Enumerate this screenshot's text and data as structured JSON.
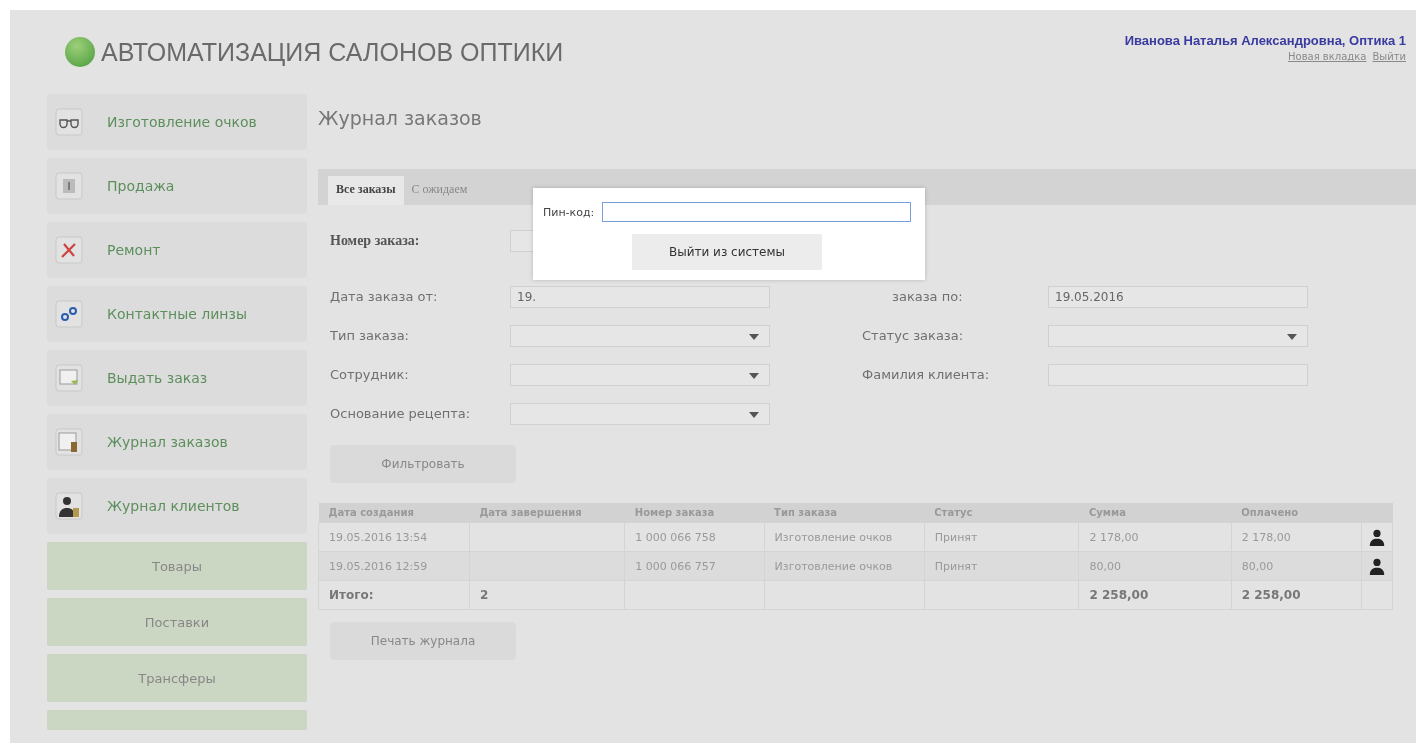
{
  "header": {
    "title": "АВТОМАТИЗАЦИЯ САЛОНОВ ОПТИКИ",
    "user": "Иванова Наталья Александровна, Оптика 1",
    "links": [
      "Новая вкладка",
      "Выйти"
    ]
  },
  "sidebar": {
    "items": [
      {
        "label": "Изготовление очков",
        "kind": "glasses"
      },
      {
        "label": "Продажа",
        "kind": "sale"
      },
      {
        "label": "Ремонт",
        "kind": "repair"
      },
      {
        "label": "Контактные линзы",
        "kind": "lenses"
      },
      {
        "label": "Выдать заказ",
        "kind": "issue"
      },
      {
        "label": "Журнал заказов",
        "kind": "journal"
      },
      {
        "label": "Журнал клиентов",
        "kind": "clients"
      }
    ],
    "buttons": [
      "Товары",
      "Поставки",
      "Трансферы"
    ]
  },
  "page_title": "Журнал заказов",
  "tabs": [
    {
      "label": "Все заказы",
      "selected": true
    },
    {
      "label": "С ожидаем",
      "selected": false
    }
  ],
  "filters": {
    "order_number": {
      "label": "Номер заказа:"
    },
    "fields": [
      {
        "label": "Дата заказа от:",
        "value": "19.",
        "kind": "text"
      },
      {
        "label": "заказа по:",
        "value": "19.05.2016",
        "kind": "text"
      },
      {
        "label": "Тип заказа:",
        "kind": "select"
      },
      {
        "label": "Статус заказа:",
        "kind": "select"
      },
      {
        "label": "Сотрудник:",
        "kind": "select"
      },
      {
        "label": "Фамилия клиента:",
        "kind": "text"
      },
      {
        "label": "Основание рецепта:",
        "kind": "select"
      }
    ],
    "filter_button": "Фильтровать"
  },
  "table": {
    "columns": [
      "Дата создания",
      "Дата завершения",
      "Номер заказа",
      "Тип заказа",
      "Статус",
      "Сумма",
      "Оплачено"
    ],
    "rows": [
      [
        "19.05.2016 13:54",
        "",
        "1 000 066 758",
        "Изготовление очков",
        "Принят",
        "2 178,00",
        "2 178,00"
      ],
      [
        "19.05.2016 12:59",
        "",
        "1 000 066 757",
        "Изготовление очков",
        "Принят",
        "80,00",
        "80,00"
      ]
    ],
    "total": {
      "label": "Итого:",
      "count": "2",
      "sum": "2 258,00",
      "paid": "2 258,00"
    }
  },
  "print_button": "Печать журнала",
  "dialog": {
    "pin_label": "Пин-код:",
    "logout_button": "Выйти из системы"
  }
}
